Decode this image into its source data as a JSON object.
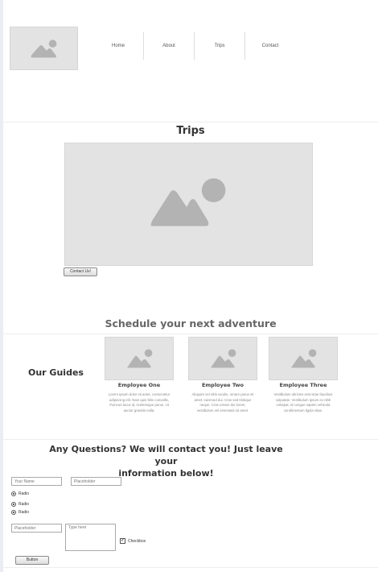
{
  "nav": {
    "items": [
      "Home",
      "About",
      "Trips",
      "Contact"
    ]
  },
  "trips": {
    "title": "Trips",
    "button": "Contact Us!"
  },
  "schedule": {
    "title": "Schedule your next adventure"
  },
  "guides": {
    "title": "Our Guides",
    "employees": [
      {
        "name": "Employee One",
        "bio": "Lorem ipsum dolor sit amet, consectetur adipiscing elit. Nam quis felis convallis, rhoncus lacus id, scelerisque purus. Ut auctor gravida nulla."
      },
      {
        "name": "Employee Two",
        "bio": "Aliquam vel nibh iaculis, ornare purus sit amet, euismod dui. Cras sed tristique neque. Cras ornare dui lorem, vestibulum vel venenatis sit amet."
      },
      {
        "name": "Employee Three",
        "bio": "Vestibulum ultricies erat vitae faucibus vulputate. Vestibulum ipsum ex nibh volutpat, id congue sapien vehicula condimentum ligula vitae."
      }
    ]
  },
  "contact": {
    "title_line1": "Any Questions? We will contact you! Just leave your",
    "title_line2": "information below!",
    "name_placeholder": "Your Name",
    "field2_placeholder": "Placeholder",
    "radios": [
      "Radio",
      "Radio",
      "Radio"
    ],
    "field3_placeholder": "Placeholder",
    "textarea_placeholder": "Type here",
    "checkbox_label": "Checkbox",
    "checkbox_checked": true,
    "button": "Button"
  },
  "colors": {
    "placeholder_bg": "#e3e3e3",
    "placeholder_icon": "#b3b3b3",
    "title": "#333333",
    "subtitle": "#666666"
  }
}
